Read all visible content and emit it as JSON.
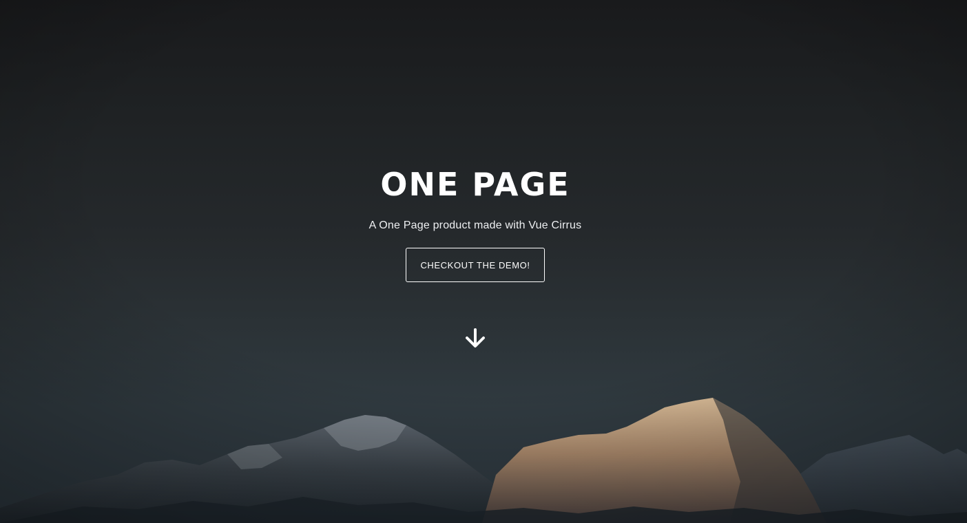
{
  "hero": {
    "title": "ONE PAGE",
    "subtitle": "A One Page product made with Vue Cirrus",
    "cta_label": "CHECKOUT THE DEMO!",
    "scroll_icon": "arrow-down-icon",
    "background": "mountain-landscape-photo"
  },
  "colors": {
    "text": "#ffffff",
    "sky_top": "#191a1c",
    "sky_bottom": "#303a40",
    "peak_highlight": "#c9a987"
  }
}
